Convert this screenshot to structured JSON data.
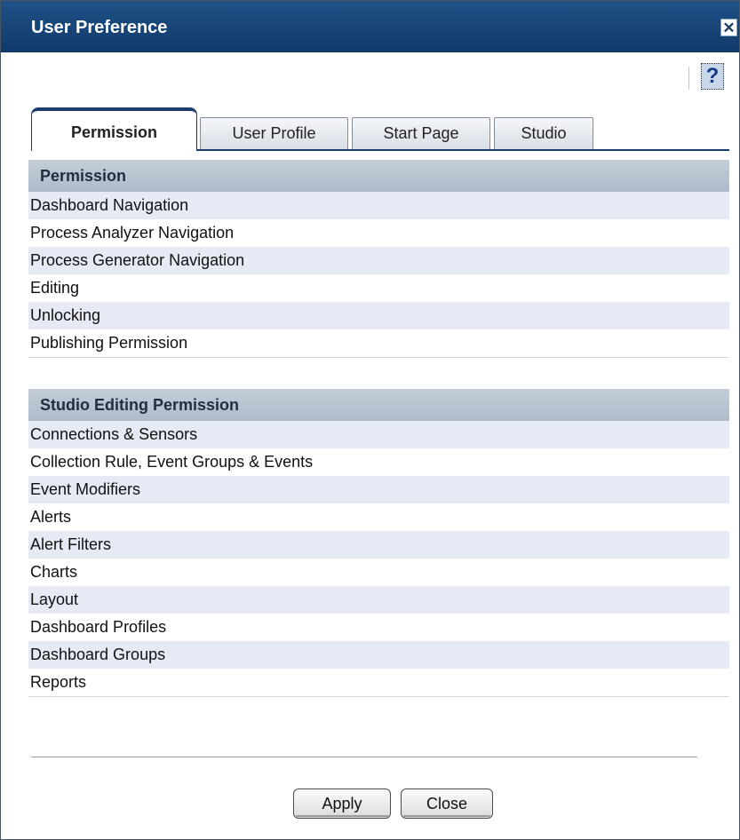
{
  "window": {
    "title": "User Preference",
    "close_glyph": "✕"
  },
  "help": {
    "icon": "help-icon",
    "glyph": "?"
  },
  "tabs": [
    {
      "label": "Permission",
      "active": true
    },
    {
      "label": "User Profile",
      "active": false
    },
    {
      "label": "Start Page",
      "active": false
    },
    {
      "label": "Studio",
      "active": false
    }
  ],
  "permission_section": {
    "header": "Permission",
    "items": [
      "Dashboard Navigation",
      "Process Analyzer Navigation",
      "Process Generator Navigation",
      "Editing",
      "Unlocking",
      "Publishing Permission"
    ]
  },
  "studio_section": {
    "header": "Studio Editing Permission",
    "items": [
      "Connections & Sensors",
      "Collection Rule, Event Groups & Events",
      "Event Modifiers",
      "Alerts",
      "Alert Filters",
      "Charts",
      "Layout",
      "Dashboard Profiles",
      "Dashboard Groups",
      "Reports"
    ]
  },
  "buttons": {
    "apply": "Apply",
    "close": "Close"
  },
  "colors": {
    "titlebar": "#1e5287",
    "section_header": "#b4c0cf",
    "row_alt": "#e6eaf5"
  }
}
